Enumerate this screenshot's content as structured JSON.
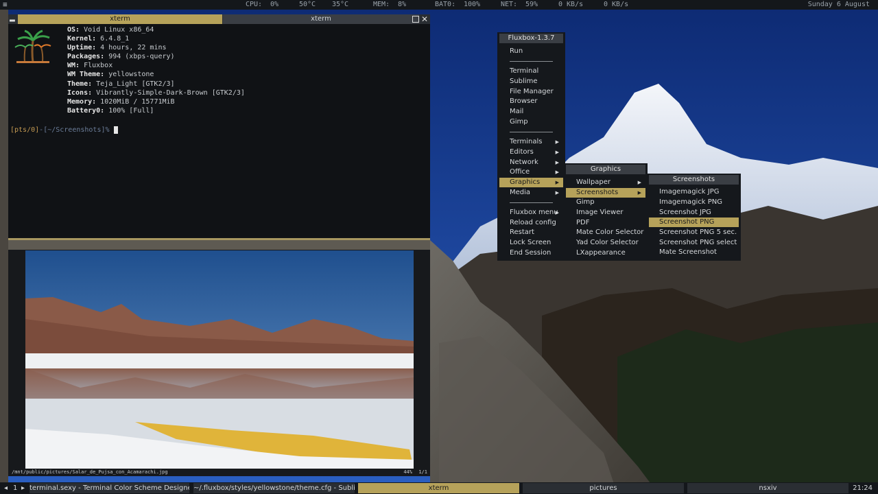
{
  "topbar": {
    "cpu_label": "CPU:",
    "cpu_value": "0%",
    "cpu_temp": "50°C",
    "gpu_temp": "35°C",
    "mem_label": "MEM:",
    "mem_value": "8%",
    "bat_label": "BAT0:",
    "bat_value": "100%",
    "net_label": "NET:",
    "net_value": "59%",
    "net_down": "0 KB/s",
    "net_up": "0 KB/s",
    "date": "Sunday  6 August",
    "menu_icon": "hamburger-icon"
  },
  "xterm": {
    "tabs": [
      "xterm",
      "xterm"
    ],
    "fetch": [
      {
        "key": "OS:",
        "value": " Void Linux x86_64"
      },
      {
        "key": "Kernel:",
        "value": " 6.4.8_1"
      },
      {
        "key": "Uptime:",
        "value": " 4 hours, 22 mins"
      },
      {
        "key": "Packages:",
        "value": " 994 (xbps-query)"
      },
      {
        "key": "WM:",
        "value": " Fluxbox"
      },
      {
        "key": "WM Theme:",
        "value": " yellowstone"
      },
      {
        "key": "Theme:",
        "value": " Teja_Light [GTK2/3]"
      },
      {
        "key": "Icons:",
        "value": " Vibrantly-Simple-Dark-Brown [GTK2/3]"
      },
      {
        "key": "Memory:",
        "value": " 1020MiB / 15771MiB"
      },
      {
        "key": "Battery0:",
        "value": " 100% [Full]"
      }
    ],
    "prompt_tty": "[pts/0]",
    "prompt_sep": "-",
    "prompt_path": "[~/Screenshots]",
    "prompt_char": "%"
  },
  "nsxiv": {
    "path": "/mnt/public/pictures/Salar_de_Pujsa_con_Acamarachi.jpg",
    "zoom": "44%",
    "count": "1/1"
  },
  "menu": {
    "title": "Fluxbox-1.3.7",
    "items": [
      "Run",
      "Terminal",
      "Sublime",
      "File Manager",
      "Browser",
      "Mail",
      "Gimp",
      "Terminals",
      "Editors",
      "Network",
      "Office",
      "Graphics",
      "Media",
      "Fluxbox menu",
      "Reload config",
      "Restart",
      "Lock Screen",
      "End Session"
    ],
    "graphics": {
      "title": "Graphics",
      "items": [
        "Wallpaper",
        "Screenshots",
        "Gimp",
        "Image Viewer",
        "PDF",
        "Mate Color Selector",
        "Yad Color Selector",
        "LXappearance"
      ]
    },
    "screenshots": {
      "title": "Screenshots",
      "items": [
        "Imagemagick JPG",
        "Imagemagick PNG",
        "Screenshot JPG",
        "Screenshot PNG",
        "Screenshot PNG 5 sec.",
        "Screenshot PNG select",
        "Mate Screenshot"
      ]
    }
  },
  "taskbar": {
    "workspace": "1",
    "tasks": [
      "terminal.sexy - Terminal Color Scheme Designer",
      "~/.fluxbox/styles/yellowstone/theme.cfg - Subli",
      "xterm",
      "pictures",
      "nsxiv"
    ],
    "clock": "21:24"
  },
  "colors": {
    "accent": "#b6a25a",
    "bar_bg": "#14171b",
    "menu_bg": "#15181c"
  }
}
